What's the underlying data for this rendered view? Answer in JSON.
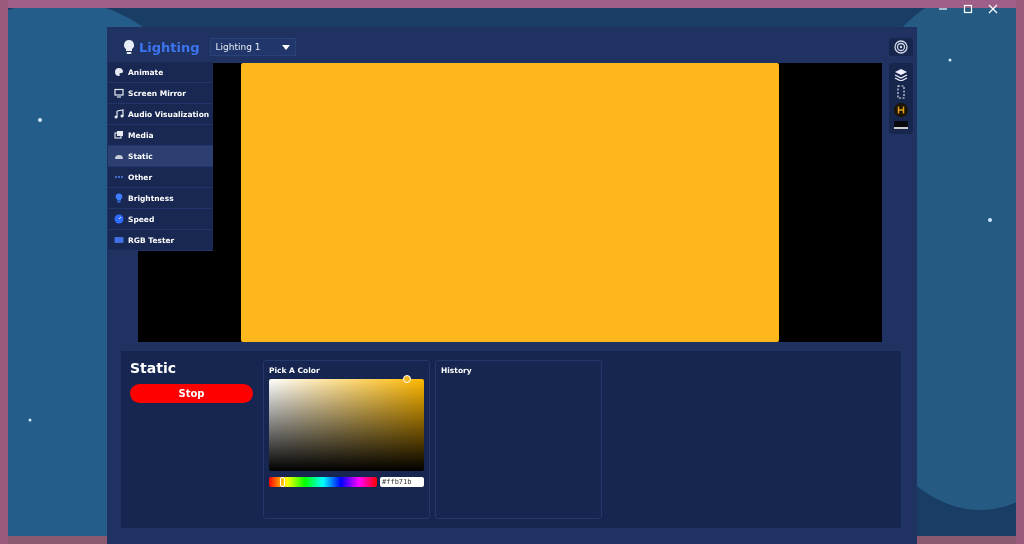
{
  "header": {
    "title": "Lighting",
    "device_select": "Lighting 1"
  },
  "menu": {
    "items": [
      {
        "label": "Animate",
        "selected": false
      },
      {
        "label": "Screen Mirror",
        "selected": false
      },
      {
        "label": "Audio Visualization",
        "selected": false
      },
      {
        "label": "Media",
        "selected": false
      },
      {
        "label": "Static",
        "selected": true
      },
      {
        "label": "Other",
        "selected": false
      },
      {
        "label": "Brightness",
        "selected": false
      },
      {
        "label": "Speed",
        "selected": false
      },
      {
        "label": "RGB Tester",
        "selected": false
      }
    ]
  },
  "preview": {
    "color": "#ffb71b"
  },
  "effect_panel": {
    "title": "Static",
    "stop_button": "Stop",
    "picker": {
      "title": "Pick A Color",
      "saturation": {
        "level": 0.89
      },
      "hue": {
        "level": 0.12
      },
      "hex_value": "#ffb71b"
    },
    "history": {
      "title": "History"
    }
  }
}
